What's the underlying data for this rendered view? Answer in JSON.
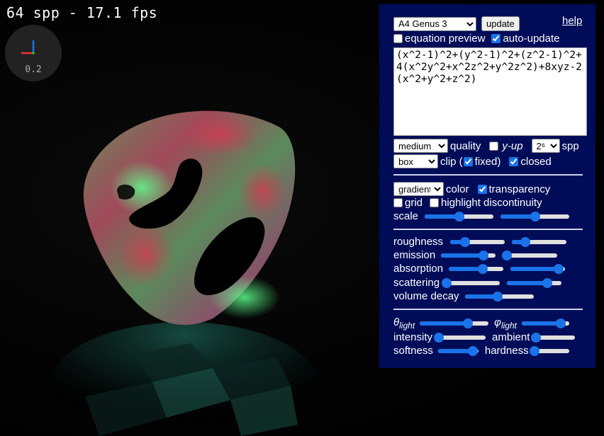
{
  "status": {
    "fps_text": "64 spp - 17.1 fps"
  },
  "axes": {
    "scale": "0.2"
  },
  "panel": {
    "preset_select": "A4 Genus 3",
    "update_label": "update",
    "help_label": "help",
    "equation_preview_label": "equation preview",
    "equation_preview_checked": false,
    "auto_update_label": "auto-update",
    "auto_update_checked": true,
    "equation": "(x^2-1)^2+(y^2-1)^2+(z^2-1)^2+4(x^2y^2+x^2z^2+y^2z^2)+8xyz-2(x^2+y^2+z^2)",
    "quality_select": "medium",
    "quality_label": "quality",
    "y_up_label": "y-up",
    "y_up_checked": false,
    "spp_select": "2⁶",
    "spp_label": "spp",
    "clip_select": "box",
    "clip_label": "clip (",
    "fixed_label": "fixed)",
    "fixed_checked": true,
    "closed_label": "closed",
    "closed_checked": true,
    "color_select": "gradient",
    "color_label": "color",
    "transparency_label": "transparency",
    "transparency_checked": true,
    "grid_label": "grid",
    "grid_checked": false,
    "highlight_label": "highlight discontinuity",
    "highlight_checked": false,
    "scale_label": "scale",
    "scale_values": [
      0.5,
      0.5
    ],
    "roughness_label": "roughness",
    "roughness_values": [
      0.27,
      0.24
    ],
    "emission_label": "emission",
    "emission_values": [
      0.78,
      0.07
    ],
    "absorption_label": "absorption",
    "absorption_values": [
      0.62,
      0.88
    ],
    "scattering_label": "scattering",
    "scattering_values": [
      0.03,
      0.74
    ],
    "volume_decay_label": "volume decay",
    "volume_decay_values": [
      0.48
    ],
    "theta_label": "θ",
    "theta_sub": "light",
    "theta_values": [
      0.7
    ],
    "phi_label": "φ",
    "phi_sub": "light",
    "phi_values": [
      0.82
    ],
    "intensity_label": "intensity",
    "intensity_values": [
      0.02
    ],
    "ambient_label": "ambient",
    "ambient_values": [
      0.02
    ],
    "softness_label": "softness",
    "softness_values": [
      0.87
    ],
    "hardness_label": "hardness",
    "hardness_values": [
      0.02
    ]
  },
  "colors": {
    "panel_bg": "#000c58",
    "accent": "#1a73e8"
  }
}
